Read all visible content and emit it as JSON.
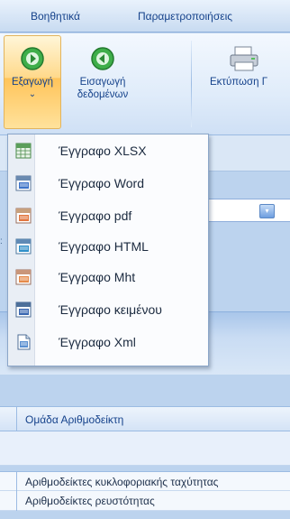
{
  "ribbon_tabs": [
    "Βοηθητικά",
    "Παραμετροποιήσεις"
  ],
  "ribbon": {
    "export_label": "Εξαγωγή",
    "export_chevron": "⌄",
    "import_label_line1": "Εισαγωγή",
    "import_label_line2": "δεδομένων",
    "print_label": "Εκτύπωση Γ"
  },
  "export_menu": {
    "items": [
      {
        "label": "Έγγραφο XLSX",
        "icon": "xlsx-file-icon"
      },
      {
        "label": "Έγγραφο Word",
        "icon": "word-file-icon"
      },
      {
        "label": "Έγγραφο pdf",
        "icon": "pdf-file-icon"
      },
      {
        "label": "Έγγραφο HTML",
        "icon": "html-file-icon"
      },
      {
        "label": "Έγγραφο Mht",
        "icon": "mht-file-icon"
      },
      {
        "label": "Έγγραφο κειμένου",
        "icon": "text-file-icon"
      },
      {
        "label": "Έγγραφο Xml",
        "icon": "xml-file-icon"
      }
    ]
  },
  "grid": {
    "group_header": "Ομάδα Αριθμοδείκτη",
    "rows": [
      "Αριθμοδείκτες κυκλοφοριακής ταχύτητας",
      "Αριθμοδείκτες ρευστότητας"
    ]
  },
  "side_marker": ":",
  "combo_arrow": "▾",
  "colors": {
    "ribbon_text": "#15428b",
    "highlight": "#ffc45a",
    "menu_background": "#fbfcfe"
  }
}
